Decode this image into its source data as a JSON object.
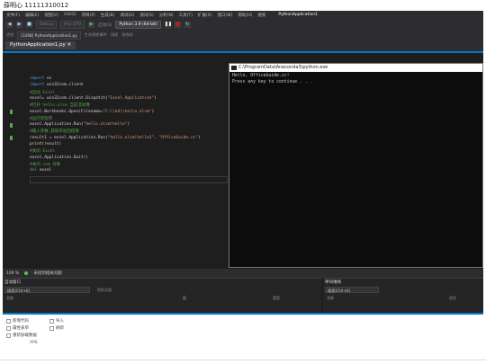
{
  "caption": "薛明心 11111310012",
  "menu": {
    "items": [
      "文件(F)",
      "编辑(E)",
      "视图(V)",
      "Git(G)",
      "项目(P)",
      "生成(B)",
      "调试(D)",
      "测试(S)",
      "分析(N)",
      "工具(T)",
      "扩展(X)",
      "窗口(W)",
      "帮助(H)",
      "搜索"
    ],
    "app_name": "PythonApplication1"
  },
  "toolbar": {
    "config": "Debug",
    "platform": "Any CPU",
    "run_label": "启动(S)",
    "python_env": "Python 3.9 (64-bit)"
  },
  "navbar": {
    "process_label": "进程",
    "process_value": "[3268] PythonApplication1.py",
    "lifecycle": "生命周期事件",
    "thread": "线程",
    "stack_frame": "堆栈帧"
  },
  "editor": {
    "tab_title": "PythonApplication1.py",
    "result_label": "result",
    "code": [
      {
        "kw": "import",
        "rest": " os",
        "type": "code"
      },
      {
        "kw": "import",
        "rest": " win32com.client",
        "type": "code"
      },
      {
        "comment": "#启动 Excel",
        "type": "comment"
      },
      {
        "plain": "excel= win32com.client.Dispatch(",
        "str": "\"Excel.Application\"",
        "end": ")",
        "type": "mixed"
      },
      {
        "comment": "#打开 hello.xlsm 当前活动簿",
        "type": "comment"
      },
      {
        "plain": "excel.Workbooks.Open(Filename=",
        "str": "\"C:\\\\kd\\\\hello.xlsm\"",
        "end": ")",
        "type": "mixed"
      },
      {
        "comment": "#运行宏程序",
        "type": "comment"
      },
      {
        "plain": "excel.Application.Run(",
        "str": "\"hello.xlsm!hello\"",
        "end": ")",
        "type": "mixed"
      },
      {
        "comment": "#输入参数,获取带返回结果",
        "type": "comment"
      },
      {
        "plain": "result1 = excel.Application.Run(",
        "str": "\"hello.xlsm!hello2\", \"OfficeGuide.cc\"",
        "end": ")",
        "type": "mixed"
      },
      {
        "fn": "print",
        "rest": "(result)",
        "type": "fncall"
      },
      {
        "comment": "#关闭 Excel",
        "type": "comment"
      },
      {
        "plain": "excel.Application.Quit()",
        "type": "plain"
      },
      {
        "comment": "#关闭 com 对象",
        "type": "comment"
      },
      {
        "kw": "del",
        "rest": " excel",
        "type": "code"
      }
    ]
  },
  "console": {
    "title": "C:\\ProgramData\\Anaconda3\\python.exe",
    "lines": [
      "Hello, OfficeGuide.cc!",
      "Press any key to continue . . ."
    ]
  },
  "status": {
    "zoom": "100 %",
    "issues": "未找到相关问题"
  },
  "locals_panel": {
    "title": "自动窗口",
    "search_placeholder": "搜索(Ctrl+E)",
    "depth_label": "搜索深度:",
    "col_name": "名称",
    "col_value": "值",
    "col_type": "类型"
  },
  "watch_panel": {
    "title": "呼叫堆栈",
    "search_placeholder": "搜索(Ctrl+E)",
    "col_name": "名称",
    "col_lang": "语言"
  },
  "ribbon": {
    "items": [
      {
        "label": "新增代码",
        "icon": "code-icon"
      },
      {
        "label": "导入",
        "icon": "import-icon"
      },
      {
        "label": "属性表单",
        "icon": "properties-icon"
      },
      {
        "label": "刷新",
        "icon": "refresh-icon"
      },
      {
        "label": "重新加载数据",
        "icon": "reload-icon"
      }
    ],
    "group_label": "XML"
  },
  "colors": {
    "accent": "#007acc",
    "comment": "#57a64a",
    "keyword": "#569cd6",
    "string": "#d69d85"
  }
}
